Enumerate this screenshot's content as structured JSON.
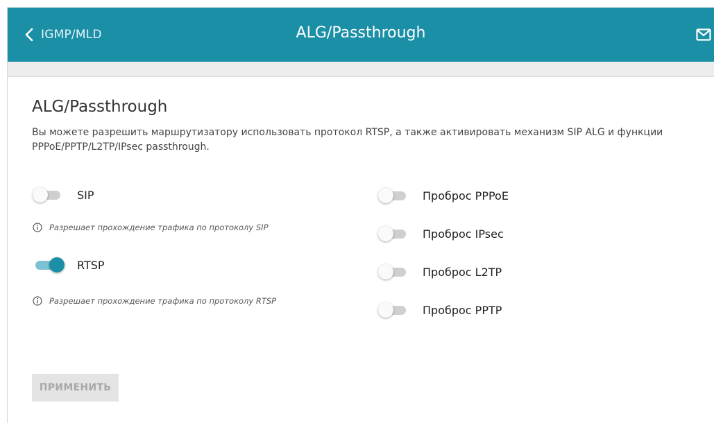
{
  "header": {
    "back_label": "IGMP/MLD",
    "title": "ALG/Passthrough"
  },
  "main": {
    "heading": "ALG/Passthrough",
    "description": "Вы можете разрешить маршрутизатору использовать протокол RTSP, а также активировать механизм SIP ALG и функции PPPoE/PPTP/L2TP/IPsec passthrough.",
    "toggles": {
      "sip": {
        "label": "SIP",
        "enabled": false,
        "hint": "Разрешает прохождение трафика по протоколу SIP"
      },
      "rtsp": {
        "label": "RTSP",
        "enabled": true,
        "hint": "Разрешает прохождение трафика по протоколу RTSP"
      },
      "pppoe": {
        "label": "Проброс PPPoE",
        "enabled": false
      },
      "ipsec": {
        "label": "Проброс IPsec",
        "enabled": false
      },
      "l2tp": {
        "label": "Проброс L2TP",
        "enabled": false
      },
      "pptp": {
        "label": "Проброс PPTP",
        "enabled": false
      }
    },
    "apply_label": "ПРИМЕНИТЬ"
  },
  "colors": {
    "accent": "#1a8fa6",
    "toggle_on_track": "#7cc2d2",
    "toggle_off_track": "#cfcfcf"
  },
  "icons": {
    "back": "chevron-left-icon",
    "mail": "mail-icon",
    "info": "info-icon"
  }
}
